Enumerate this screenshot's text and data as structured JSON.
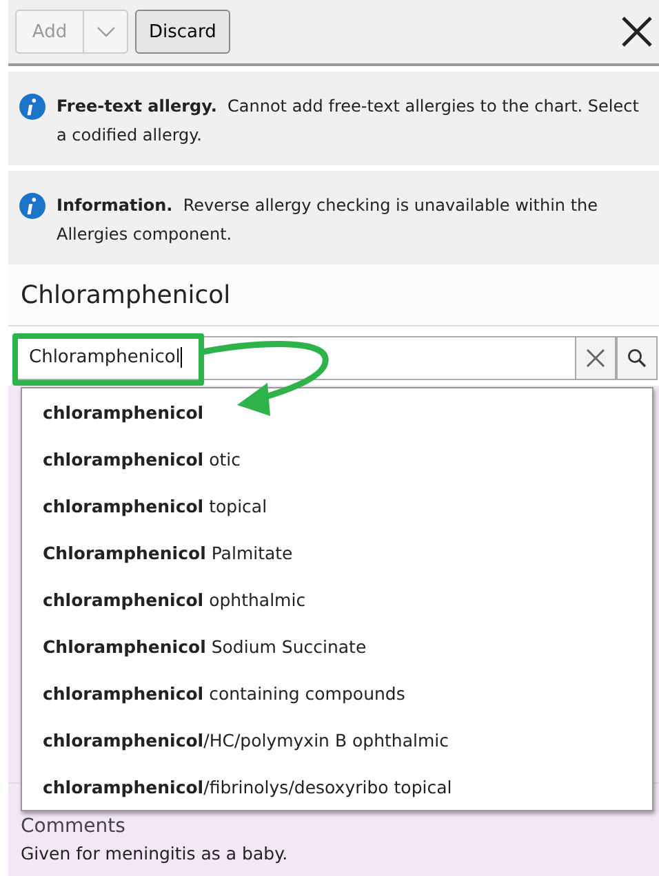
{
  "toolbar": {
    "add_button": {
      "label": "Add",
      "disabled": true
    },
    "discard_button": {
      "label": "Discard"
    }
  },
  "banners": [
    {
      "title": "Free-text allergy.",
      "message": "Cannot add free-text allergies to the chart. Select a codified allergy."
    },
    {
      "title": "Information.",
      "message": "Reverse allergy checking is unavailable within the Allergies component."
    }
  ],
  "heading": "Chloramphenicol",
  "search": {
    "value": "Chloramphenicol",
    "highlighted": true
  },
  "suggestions": [
    {
      "label": "**chloramphenicol**"
    },
    {
      "label": "**chloramphenicol** otic"
    },
    {
      "label": "**chloramphenicol** topical"
    },
    {
      "label": "**Chloramphenicol** Palmitate"
    },
    {
      "label": "**chloramphenicol** ophthalmic"
    },
    {
      "label": "**Chloramphenicol** Sodium Succinate"
    },
    {
      "label": "**chloramphenicol** containing compounds"
    },
    {
      "label": "**chloramphenicol**/HC/polymyxin B ophthalmic"
    },
    {
      "label": "**chloramphenicol**/fibrinolys/desoxyribo topical"
    }
  ],
  "comments": {
    "label": "Comments",
    "text": "Given for meningitis as a baby."
  }
}
